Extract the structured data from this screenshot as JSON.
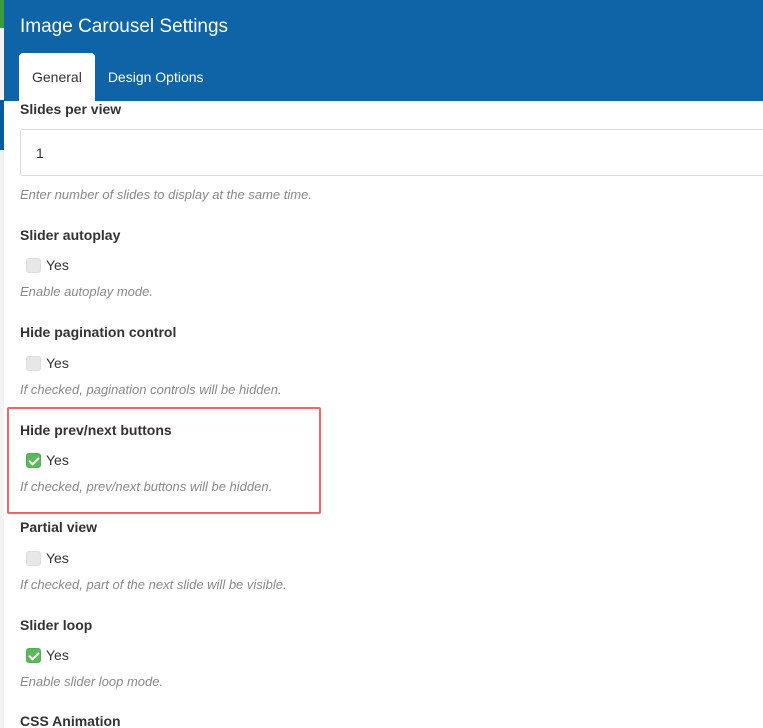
{
  "window": {
    "title": "Image Carousel Settings"
  },
  "tabs": [
    {
      "label": "General",
      "active": true
    },
    {
      "label": "Design Options",
      "active": false
    }
  ],
  "fields": {
    "slides_per_view": {
      "label": "Slides per view",
      "value": "1",
      "help": "Enter number of slides to display at the same time."
    },
    "slider_autoplay": {
      "label": "Slider autoplay",
      "option": "Yes",
      "checked": false,
      "help": "Enable autoplay mode."
    },
    "hide_pagination": {
      "label": "Hide pagination control",
      "option": "Yes",
      "checked": false,
      "help": "If checked, pagination controls will be hidden."
    },
    "hide_prev_next": {
      "label": "Hide prev/next buttons",
      "option": "Yes",
      "checked": true,
      "help": "If checked, prev/next buttons will be hidden."
    },
    "partial_view": {
      "label": "Partial view",
      "option": "Yes",
      "checked": false,
      "help": "If checked, part of the next slide will be visible."
    },
    "slider_loop": {
      "label": "Slider loop",
      "option": "Yes",
      "checked": true,
      "help": "Enable slider loop mode."
    },
    "css_animation": {
      "label": "CSS Animation"
    }
  },
  "colors": {
    "header": "#0e64a6",
    "checkbox_checked": "#5cb85c",
    "highlight": "#e8696b"
  }
}
